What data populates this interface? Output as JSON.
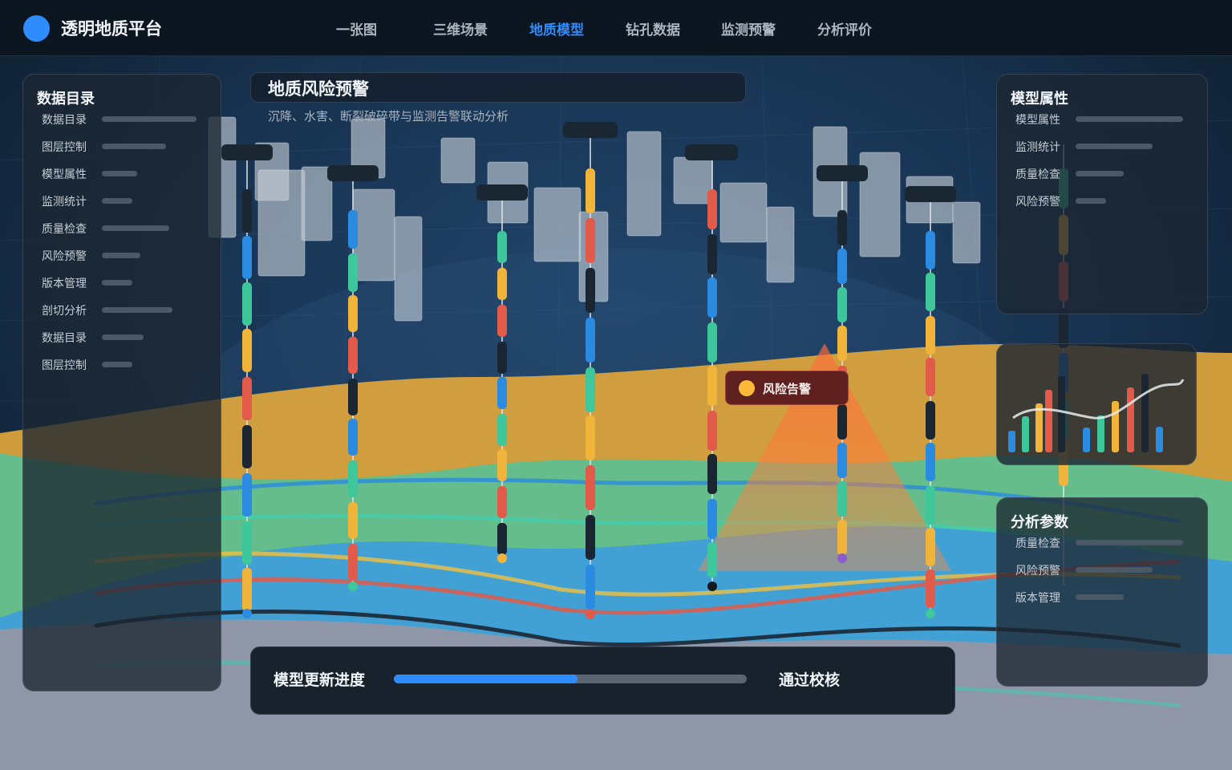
{
  "app": {
    "title": "透明地质平台"
  },
  "nav": {
    "items": [
      "一张图",
      "三维场景",
      "地质模型",
      "钻孔数据",
      "监测预警",
      "分析评价"
    ],
    "active_index": 2
  },
  "left_panel": {
    "title": "数据目录",
    "items": [
      "数据目录",
      "图层控制",
      "模型属性",
      "监测统计",
      "质量检查",
      "风险预警",
      "版本管理",
      "剖切分析",
      "数据目录",
      "图层控制"
    ]
  },
  "header": {
    "title": "地质风险预警",
    "subtitle": "沉降、水害、断裂破碎带与监测告警联动分析"
  },
  "alert": {
    "label": "风险告警"
  },
  "right_top_panel": {
    "title": "模型属性",
    "items": [
      "模型属性",
      "监测统计",
      "质量检查",
      "风险预警"
    ]
  },
  "right_bottom_panel": {
    "title": "分析参数",
    "items": [
      "质量检查",
      "风险预警",
      "版本管理"
    ]
  },
  "progress": {
    "label": "模型更新进度",
    "value": 0.52,
    "status": "通过校核"
  },
  "colors": {
    "accent": "#2f8cff",
    "layer_yellow": "#e0a63c",
    "layer_green": "#5fbf8f",
    "layer_blue": "#3f9fd8",
    "alert_red": "#e0604a",
    "alert_orange": "#ff8a3a"
  }
}
